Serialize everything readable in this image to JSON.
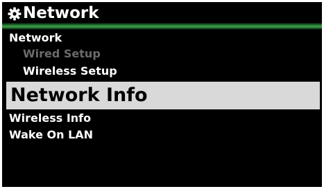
{
  "header": {
    "title": "Network",
    "icon": "gear-icon"
  },
  "menu": {
    "section_label": "Network",
    "items": [
      {
        "label": "Wired Setup",
        "state": "disabled"
      },
      {
        "label": "Wireless Setup",
        "state": "normal"
      },
      {
        "label": "Network Info",
        "state": "selected"
      },
      {
        "label": "Wireless Info",
        "state": "normal"
      },
      {
        "label": "Wake On LAN",
        "state": "normal"
      }
    ]
  },
  "colors": {
    "background": "#000000",
    "text": "#ffffff",
    "disabled_text": "#6b6b6b",
    "selected_bg": "#d9d9d9",
    "selected_text": "#000000",
    "accent_line": "#3fa04a"
  }
}
